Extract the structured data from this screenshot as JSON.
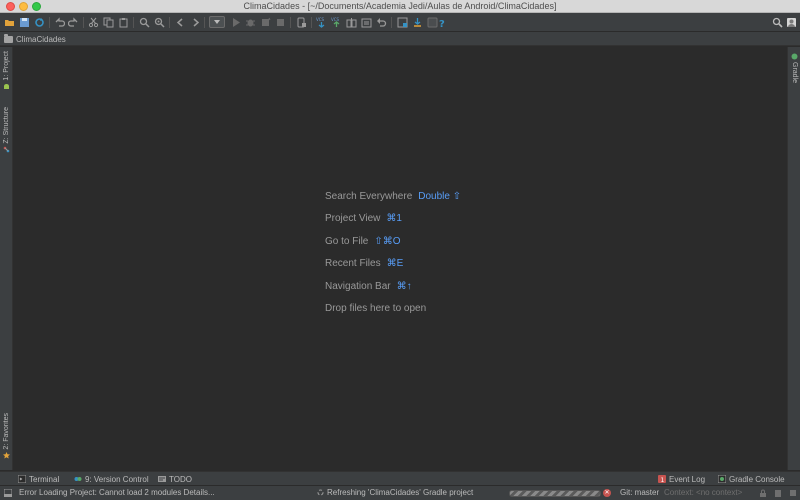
{
  "window": {
    "title": "ClimaCidades - [~/Documents/Academia Jedi/Aulas de Android/ClimaCidades]"
  },
  "navbar": {
    "breadcrumb": "ClimaCidades"
  },
  "left_tabs": {
    "project": "1: Project",
    "structure": "Z: Structure",
    "favorites": "2: Favorites"
  },
  "right_tabs": {
    "gradle": "Gradle"
  },
  "editor": {
    "hints": [
      {
        "label": "Search Everywhere",
        "key": "Double ⇧"
      },
      {
        "label": "Project View",
        "key": "⌘1"
      },
      {
        "label": "Go to File",
        "key": "⇧⌘O"
      },
      {
        "label": "Recent Files",
        "key": "⌘E"
      },
      {
        "label": "Navigation Bar",
        "key": "⌘↑"
      },
      {
        "label": "Drop files here to open",
        "key": ""
      }
    ]
  },
  "bottom_tools": {
    "terminal": "Terminal",
    "version_control": "9: Version Control",
    "todo": "TODO",
    "event_log": "Event Log",
    "gradle_console": "Gradle Console"
  },
  "status": {
    "message": "Error Loading Project: Cannot load 2 modules Details...",
    "refreshing": "Refreshing 'ClimaCidades' Gradle project",
    "git": "Git: master",
    "context": "Context: <no context>"
  },
  "colors": {
    "background": "#2b2b2b",
    "panel": "#3c3f41",
    "hint_key": "#589df6"
  }
}
